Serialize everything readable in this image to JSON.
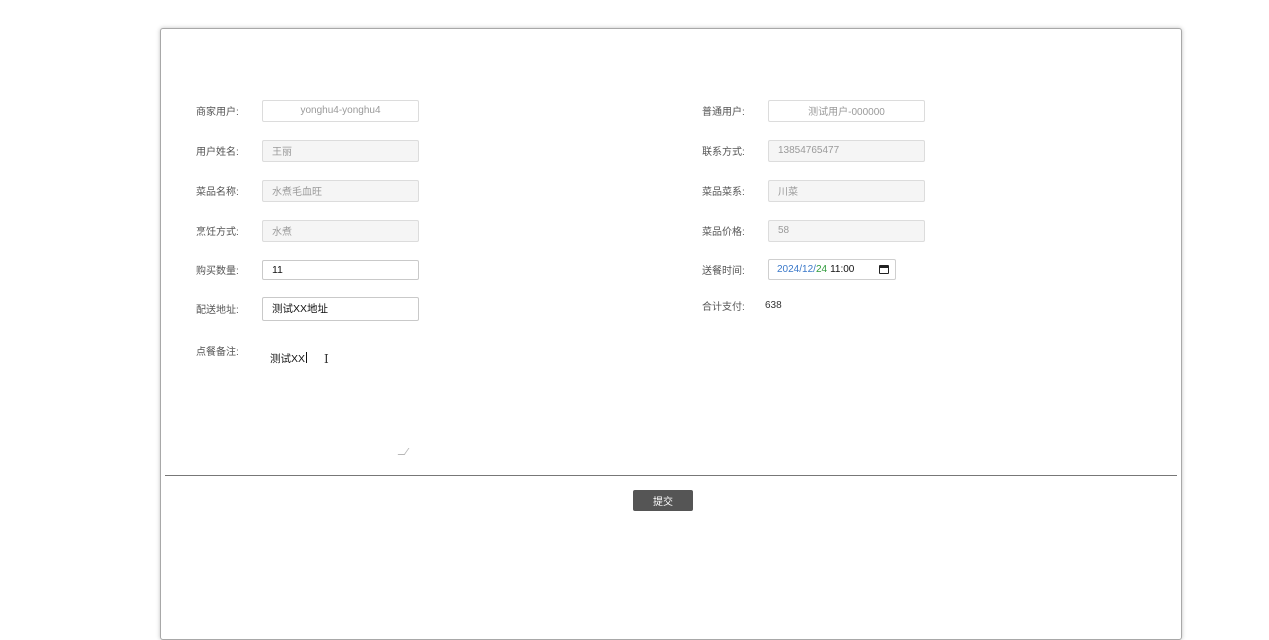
{
  "form": {
    "merchant_user": {
      "label": "商家用户:",
      "value": "yonghu4-yonghu4"
    },
    "normal_user": {
      "label": "普通用户:",
      "value": "测试用户-000000"
    },
    "user_name": {
      "label": "用户姓名:",
      "value": "王丽"
    },
    "contact": {
      "label": "联系方式:",
      "value": "13854765477"
    },
    "product_name": {
      "label": "菜品名称:",
      "value": "水煮毛血旺"
    },
    "cuisine": {
      "label": "菜品菜系:",
      "value": "川菜"
    },
    "cooking_method": {
      "label": "烹饪方式:",
      "value": "水煮"
    },
    "price": {
      "label": "菜品价格:",
      "value": "58"
    },
    "quantity": {
      "label": "购买数量:",
      "value": "11"
    },
    "delivery_time": {
      "label": "送餐时间:",
      "year": "2024",
      "month": "12",
      "day": "24",
      "time": "11:00"
    },
    "address": {
      "label": "配送地址:",
      "value": "测试XX地址"
    },
    "total": {
      "label": "合计支付:",
      "value": "638"
    },
    "remark": {
      "label": "点餐备注:",
      "value": "测试XX"
    }
  },
  "submit_label": "提交",
  "colors": {
    "button_bg": "#555555",
    "date_blue": "#3a78c9",
    "date_green": "#2e9a3a"
  }
}
